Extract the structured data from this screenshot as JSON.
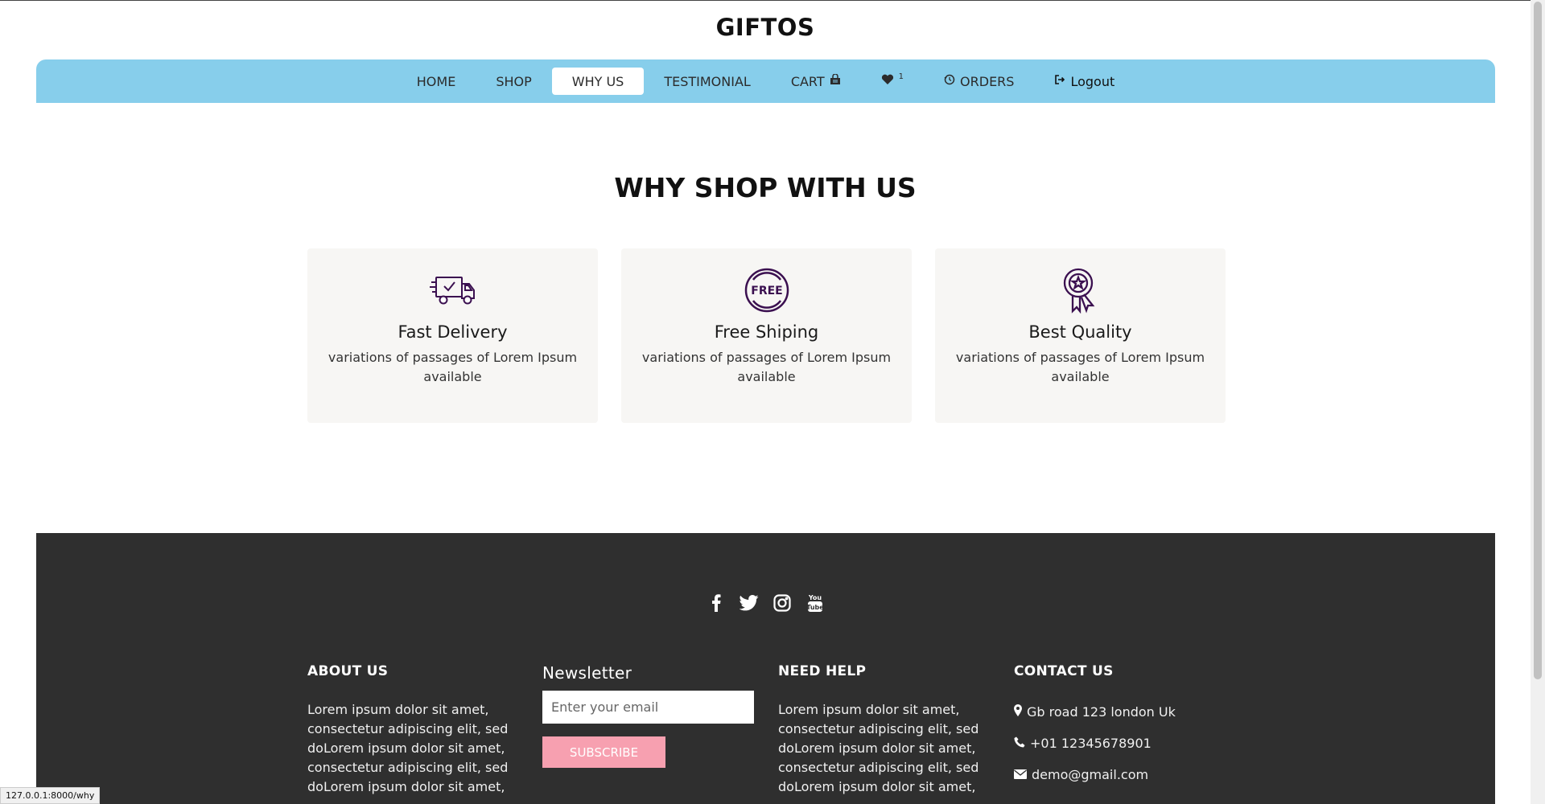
{
  "brand": "GIFTOS",
  "nav": {
    "home": "HOME",
    "shop": "SHOP",
    "why": "WHY US",
    "testimonial": "TESTIMONIAL",
    "cart": "CART",
    "wishlist_count": "1",
    "orders": "ORDERS",
    "logout": "Logout",
    "active": "WHY US",
    "bar_color": "#87ceeb"
  },
  "why": {
    "title": "WHY SHOP WITH US",
    "cards": [
      {
        "icon": "delivery-truck-icon",
        "title": "Fast Delivery",
        "text": "variations of passages of Lorem Ipsum available"
      },
      {
        "icon": "free-badge-icon",
        "title": "Free Shiping",
        "text": "variations of passages of Lorem Ipsum available"
      },
      {
        "icon": "quality-award-icon",
        "title": "Best Quality",
        "text": "variations of passages of Lorem Ipsum available"
      }
    ]
  },
  "footer": {
    "socials": [
      "facebook-icon",
      "twitter-icon",
      "instagram-icon",
      "youtube-icon"
    ],
    "about": {
      "title": "ABOUT US",
      "text": "Lorem ipsum dolor sit amet, consectetur adipiscing elit, sed doLorem ipsum dolor sit amet, consectetur adipiscing elit, sed doLorem ipsum dolor sit amet,"
    },
    "newsletter": {
      "title": "Newsletter",
      "placeholder": "Enter your email",
      "button": "SUBSCRIBE"
    },
    "help": {
      "title": "NEED HELP",
      "text": "Lorem ipsum dolor sit amet, consectetur adipiscing elit, sed doLorem ipsum dolor sit amet, consectetur adipiscing elit, sed doLorem ipsum dolor sit amet,"
    },
    "contact": {
      "title": "CONTACT US",
      "address": "Gb road 123 london Uk",
      "phone": "+01 12345678901",
      "email": "demo@gmail.com"
    }
  },
  "status_url": "127.0.0.1:8000/why",
  "colors": {
    "accent": "#87ceeb",
    "footer_bg": "#2f2f2f",
    "subscribe": "#f7a0b0",
    "icon_purple": "#3b1050"
  }
}
